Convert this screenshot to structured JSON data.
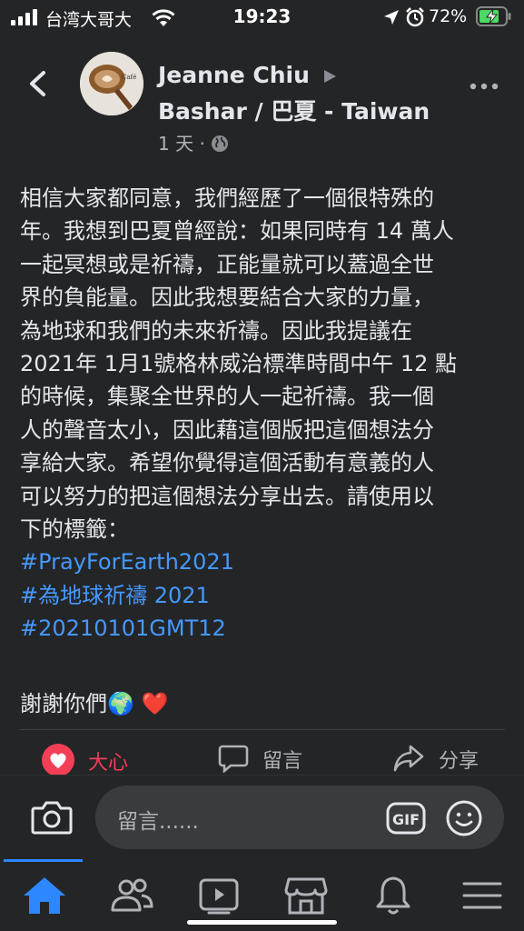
{
  "status_bar": {
    "carrier": "台湾大哥大",
    "time": "19:23",
    "battery": "72%"
  },
  "post": {
    "author": "Jeanne Chiu",
    "group": "Bashar / 巴夏 - Taiwan",
    "time_ago": "1 天",
    "body_lines": [
      "相信大家都同意，我們經歷了一個很特殊的",
      "年。我想到巴夏曾經說：如果同時有 14 萬人",
      "一起冥想或是祈禱，正能量就可以蓋過全世",
      "界的負能量。因此我想要結合大家的力量，",
      "為地球和我們的未來祈禱。因此我提議在",
      "2021年 1月1號格林威治標準時間中午 12 點",
      "的時候，集聚全世界的人一起祈禱。我一個",
      "人的聲音太小，因此藉這個版把這個想法分",
      "享給大家。希望你覺得這個活動有意義的人",
      "可以努力的把這個想法分享出去。請使用以",
      "下的標籤："
    ],
    "hashtags": [
      "#PrayForEarth2021",
      "#為地球祈禱 2021",
      "#20210101GMT12"
    ],
    "closing": "謝謝你們🌍 ❤️"
  },
  "actions": {
    "love": "大心",
    "comment": "留言",
    "share": "分享"
  },
  "comment_box": {
    "placeholder": "留言......",
    "gif": "GIF"
  },
  "icons": {
    "back": "chevron-left-icon",
    "more": "more-dots-icon",
    "globe": "globe-icon",
    "camera": "camera-icon",
    "emoji": "emoji-icon",
    "tabs": [
      "home-icon",
      "friends-icon",
      "watch-icon",
      "marketplace-icon",
      "notifications-icon",
      "menu-icon"
    ]
  },
  "colors": {
    "background": "#242526",
    "hashtag": "#4599ff",
    "love": "#f33e58",
    "active_tab": "#2d88ff"
  }
}
